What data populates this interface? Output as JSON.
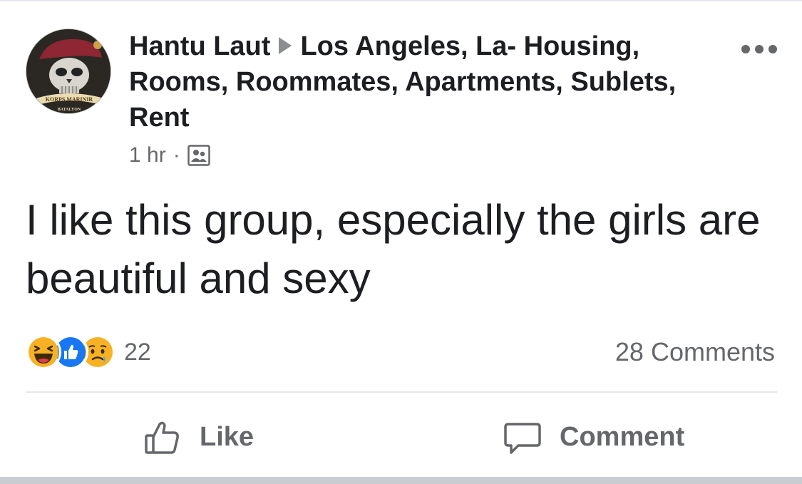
{
  "post": {
    "author": "Hantu Laut",
    "group": "Los Angeles, La- Housing, Rooms, Roommates, Apartments, Sublets, Rent",
    "time": "1 hr",
    "audience_icon": "group-members-icon",
    "text": "I like this group, especially the girls are beautiful and sexy",
    "avatar_text": {
      "line1": "KORPS MARINIR",
      "line2": "BATALYON"
    }
  },
  "reactions": {
    "icons": [
      "haha-icon",
      "like-reaction-icon",
      "sad-icon"
    ],
    "count": "22"
  },
  "comments_count": "28 Comments",
  "actions": {
    "like_label": "Like",
    "comment_label": "Comment"
  },
  "colors": {
    "text": "#1c1e21",
    "secondary": "#65676b",
    "like_blue": "#1877f2",
    "reaction_yellow": "#f7b125"
  }
}
